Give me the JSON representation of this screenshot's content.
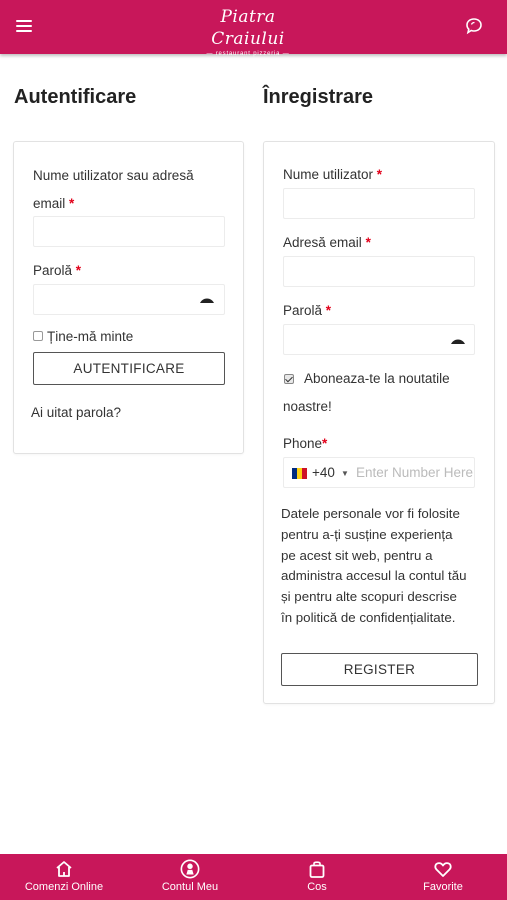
{
  "header": {
    "logo_main": "Piatra Craiului",
    "logo_sub": "restaurant pizzeria",
    "menu_icon": "hamburger-icon",
    "chat_icon": "chat-icon",
    "brand_color": "#c8175a"
  },
  "login": {
    "title": "Autentificare",
    "username_label": "Nume utilizator sau adresă email",
    "password_label": "Parolă",
    "remember_label": "Ține-mă minte",
    "submit_label": "AUTENTIFICARE",
    "forgot_label": "Ai uitat parola?",
    "required_mark": "*"
  },
  "register": {
    "title": "Înregistrare",
    "username_label": "Nume utilizator",
    "email_label": "Adresă email",
    "password_label": "Parolă",
    "newsletter_label": "Aboneaza-te la noutatile",
    "newsletter_label_2": "noastre!",
    "newsletter_checked": true,
    "phone_label": "Phone",
    "dial_code": "+40",
    "phone_placeholder": "Enter Number Here",
    "privacy_text": [
      "Datele personale vor fi folosite",
      "pentru a-ți susține experiența",
      "pe acest sit web, pentru a",
      "administra accesul la contul tău",
      "și pentru alte scopuri descrise",
      "în politică de confidențialitate."
    ],
    "submit_label": "REGISTER",
    "required_mark": "*"
  },
  "bottom_nav": {
    "items": [
      {
        "label": "Comenzi Online",
        "icon": "home-icon"
      },
      {
        "label": "Contul Meu",
        "icon": "account-icon"
      },
      {
        "label": "Cos",
        "icon": "bag-icon"
      },
      {
        "label": "Favorite",
        "icon": "heart-icon"
      }
    ]
  }
}
